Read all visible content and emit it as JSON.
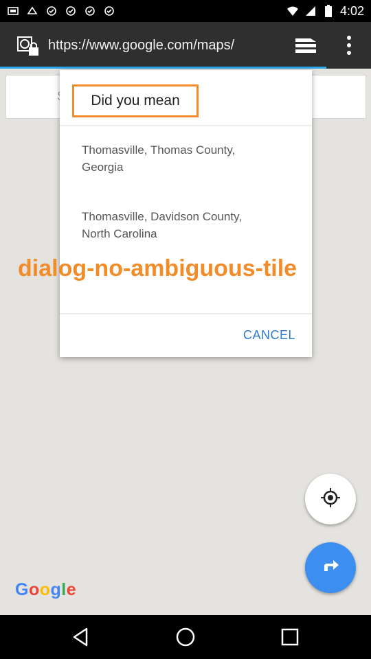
{
  "status_bar": {
    "time": "4:02",
    "icons": [
      "wifi-icon",
      "cell-signal-icon",
      "battery-icon"
    ],
    "left_icons": [
      "notification-1-icon",
      "notification-2-icon",
      "notification-3-icon",
      "notification-4-icon",
      "notification-5-icon",
      "notification-6-icon"
    ]
  },
  "browser": {
    "url": "https://www.google.com/maps/",
    "icons": [
      "site-info-icon",
      "tabs-icon",
      "overflow-menu-icon"
    ]
  },
  "map": {
    "search_hint": "S",
    "logo": "Google"
  },
  "dialog": {
    "title": "Did you mean",
    "options": [
      {
        "line1": "Thomasville, Thomas County,",
        "line2": "Georgia"
      },
      {
        "line1": "Thomasville, Davidson County,",
        "line2": "North Carolina"
      }
    ],
    "cancel_label": "CANCEL",
    "annotation_label": "dialog-no-ambiguous-tile"
  },
  "fabs": {
    "icons": [
      "my-location-icon",
      "directions-icon"
    ]
  },
  "nav_bar": {
    "icons": [
      "back-icon",
      "home-icon",
      "recents-icon"
    ]
  },
  "colors": {
    "accent_orange": "#f28c28",
    "link_blue": "#2b7bd0",
    "fab_blue": "#3c8ff0",
    "progress_blue": "#2aa5e8"
  }
}
